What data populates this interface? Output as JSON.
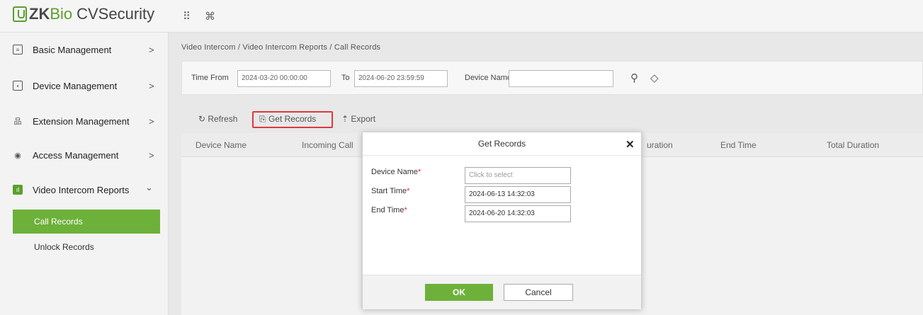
{
  "app": {
    "logo_zk": "ZK",
    "logo_bio": "Bio",
    "logo_name": "CVSecurity",
    "apps_icon": "grid-icon",
    "command_icon": "command-icon"
  },
  "sidebar": {
    "items": [
      {
        "label": "Basic Management",
        "icon": "list-icon",
        "chevron": ">"
      },
      {
        "label": "Device Management",
        "icon": "device-icon",
        "chevron": ">"
      },
      {
        "label": "Extension Management",
        "icon": "hierarchy-icon",
        "chevron": ">"
      },
      {
        "label": "Access Management",
        "icon": "shield-icon",
        "chevron": ">"
      },
      {
        "label": "Video Intercom Reports",
        "icon": "chart-icon",
        "chevron": "⌄"
      }
    ],
    "subitems": [
      {
        "label": "Call Records",
        "active": true
      },
      {
        "label": "Unlock Records",
        "active": false
      }
    ]
  },
  "breadcrumb": "Video Intercom / Video Intercom Reports / Call Records",
  "filters": {
    "time_from_label": "Time From",
    "time_from_value": "2024-03-20 00:00:00",
    "to_label": "To",
    "to_value": "2024-06-20 23:59:59",
    "device_name_label": "Device Name",
    "device_name_value": ""
  },
  "toolbar": {
    "refresh": "Refresh",
    "get_records": "Get Records",
    "export": "Export"
  },
  "table": {
    "columns": [
      "Device Name",
      "Incoming Call",
      "uration",
      "End Time",
      "Total Duration"
    ]
  },
  "modal": {
    "title": "Get Records",
    "device_name_label": "Device Name",
    "device_name_placeholder": "Click to select",
    "start_time_label": "Start Time",
    "start_time_value": "2024-06-13 14:32:03",
    "end_time_label": "End Time",
    "end_time_value": "2024-06-20 14:32:03",
    "required_mark": "*",
    "ok": "OK",
    "cancel": "Cancel"
  },
  "colors": {
    "accent": "#6db13a",
    "highlight": "#e0383e"
  }
}
